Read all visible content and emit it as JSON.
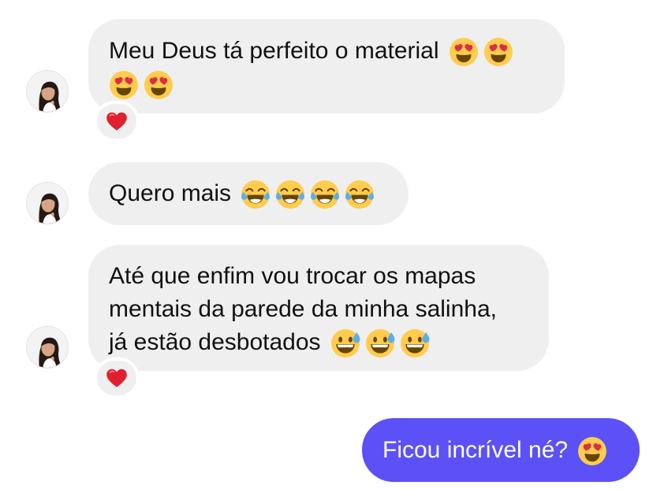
{
  "conversation": {
    "messages": [
      {
        "direction": "incoming",
        "lines": [
          {
            "text": "Meu Deus tá perfeito o material",
            "emoji": [
              "heart-eyes",
              "heart-eyes"
            ]
          },
          {
            "text": "",
            "emoji": [
              "heart-eyes",
              "heart-eyes"
            ]
          }
        ],
        "reaction": "red-heart"
      },
      {
        "direction": "incoming",
        "lines": [
          {
            "text": "Quero mais",
            "emoji": [
              "tears-of-joy",
              "tears-of-joy",
              "tears-of-joy",
              "tears-of-joy"
            ]
          }
        ],
        "reaction": null
      },
      {
        "direction": "incoming",
        "lines": [
          {
            "text": "Até que enfim vou trocar os mapas",
            "emoji": []
          },
          {
            "text": "mentais da parede da minha salinha,",
            "emoji": []
          },
          {
            "text": "já estão desbotados",
            "emoji": [
              "grinning-sweat",
              "grinning-sweat",
              "grinning-sweat"
            ]
          }
        ],
        "reaction": "red-heart"
      },
      {
        "direction": "outgoing",
        "lines": [
          {
            "text": "Ficou incrível né?",
            "emoji": [
              "heart-eyes"
            ]
          }
        ],
        "reaction": null
      }
    ]
  },
  "colors": {
    "incoming_bubble": "#efefef",
    "outgoing_bubble": "#5b51f6",
    "outgoing_text": "#ffffff",
    "reaction_heart": "#e0202e"
  }
}
